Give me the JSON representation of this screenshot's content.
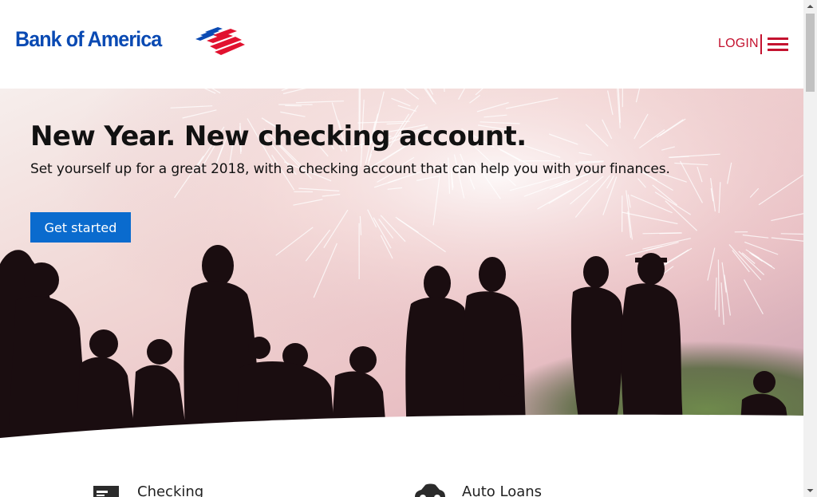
{
  "header": {
    "logo_text": "Bank of America",
    "login_label": "LOGIN",
    "menu_icon": "hamburger-menu-icon"
  },
  "hero": {
    "title": "New Year. New checking account.",
    "subtitle": "Set yourself up for a great 2018, with a checking account that can help you with your finances.",
    "cta_label": "Get started"
  },
  "products": [
    {
      "label": "Checking",
      "icon": "checking-card-icon"
    },
    {
      "label": "Auto Loans",
      "icon": "car-icon"
    }
  ],
  "colors": {
    "brand_blue": "#0a4ab3",
    "brand_red": "#c4122f",
    "cta_blue": "#0a6bce"
  }
}
